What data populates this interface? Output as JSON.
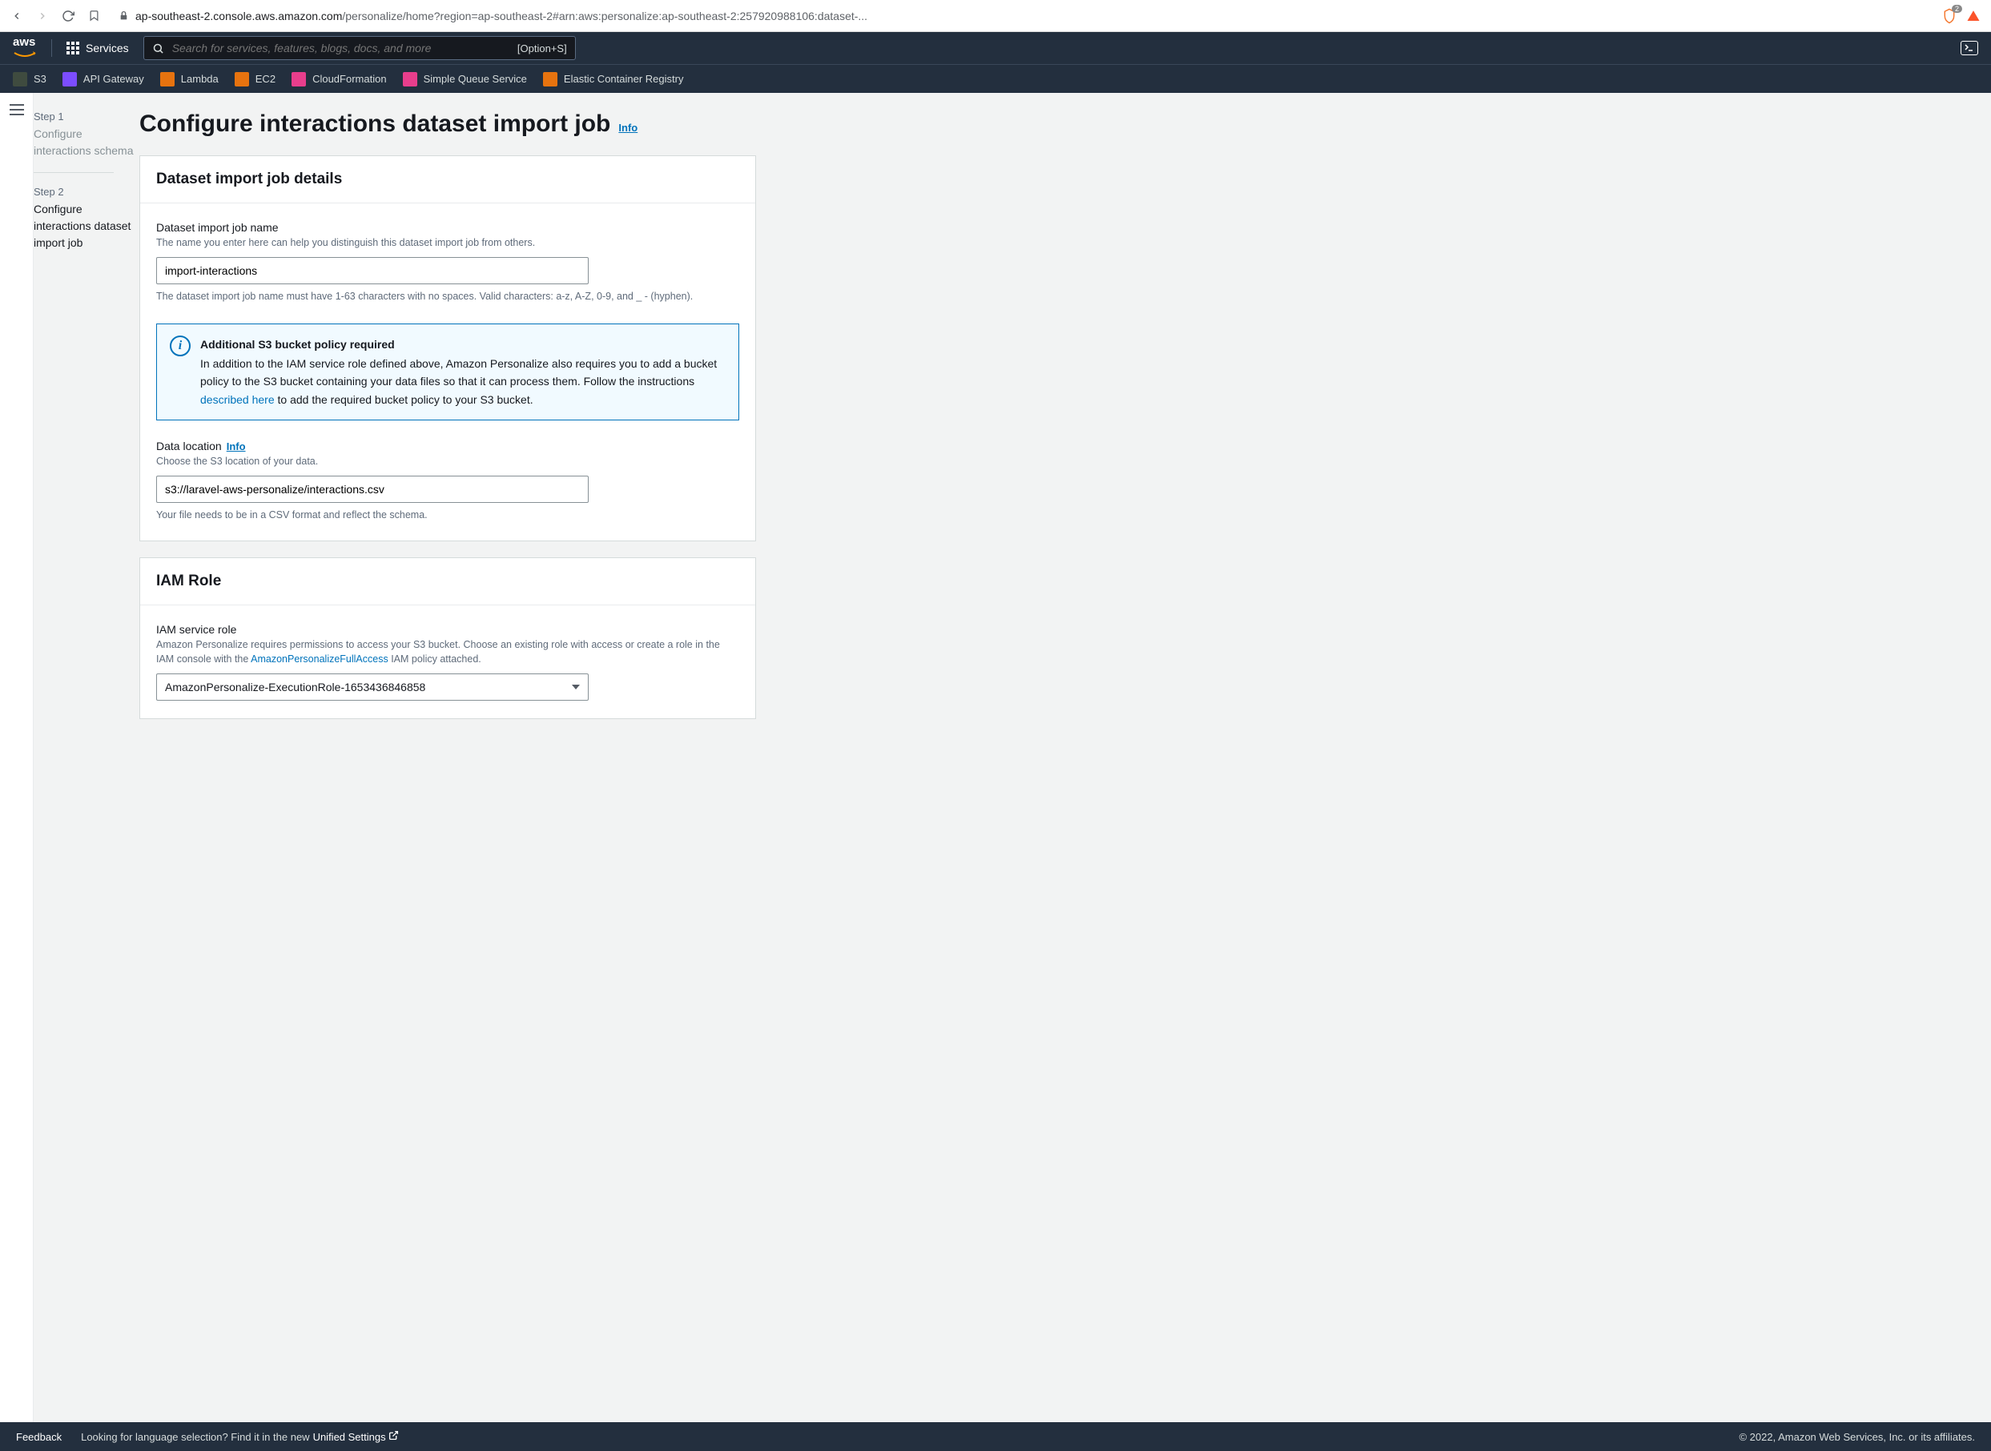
{
  "browser": {
    "url_prefix": "ap-southeast-2.console.aws.amazon.com",
    "url_path": "/personalize/home?region=ap-southeast-2#arn:aws:personalize:ap-southeast-2:257920988106:dataset-...",
    "ext_badge": "2"
  },
  "topnav": {
    "services": "Services",
    "search_placeholder": "Search for services, features, blogs, docs, and more",
    "search_hint": "[Option+S]"
  },
  "shortcuts": [
    {
      "label": "S3",
      "cls": "s3"
    },
    {
      "label": "API Gateway",
      "cls": "api"
    },
    {
      "label": "Lambda",
      "cls": "lambda"
    },
    {
      "label": "EC2",
      "cls": "ec2"
    },
    {
      "label": "CloudFormation",
      "cls": "cfn"
    },
    {
      "label": "Simple Queue Service",
      "cls": "sqs"
    },
    {
      "label": "Elastic Container Registry",
      "cls": "ecr"
    }
  ],
  "steps": [
    {
      "num": "Step 1",
      "title": "Configure interactions schema"
    },
    {
      "num": "Step 2",
      "title": "Configure interactions dataset import job"
    }
  ],
  "page": {
    "title": "Configure interactions dataset import job",
    "info": "Info"
  },
  "panel1": {
    "title": "Dataset import job details",
    "job_name_label": "Dataset import job name",
    "job_name_desc": "The name you enter here can help you distinguish this dataset import job from others.",
    "job_name_value": "import-interactions",
    "job_name_constraint": "The dataset import job name must have 1-63 characters with no spaces. Valid characters: a-z, A-Z, 0-9, and _ - (hyphen).",
    "alert_title": "Additional S3 bucket policy required",
    "alert_body1": "In addition to the IAM service role defined above, Amazon Personalize also requires you to add a bucket policy to the S3 bucket containing your data files so that it can process them. Follow the instructions ",
    "alert_link": "described here",
    "alert_body2": " to add the required bucket policy to your S3 bucket.",
    "data_loc_label": "Data location",
    "data_loc_info": "Info",
    "data_loc_desc": "Choose the S3 location of your data.",
    "data_loc_value": "s3://laravel-aws-personalize/interactions.csv",
    "data_loc_constraint": "Your file needs to be in a CSV format and reflect the schema."
  },
  "panel2": {
    "title": "IAM Role",
    "role_label": "IAM service role",
    "role_desc1": "Amazon Personalize requires permissions to access your S3 bucket. Choose an existing role with access or create a role in the IAM console with the ",
    "role_policy_link": "AmazonPersonalizeFullAccess",
    "role_desc2": " IAM policy attached.",
    "role_value": "AmazonPersonalize-ExecutionRole-1653436846858"
  },
  "footer": {
    "feedback": "Feedback",
    "lang_text": "Looking for language selection? Find it in the new ",
    "unified": "Unified Settings",
    "copyright": "© 2022, Amazon Web Services, Inc. or its affiliates."
  }
}
